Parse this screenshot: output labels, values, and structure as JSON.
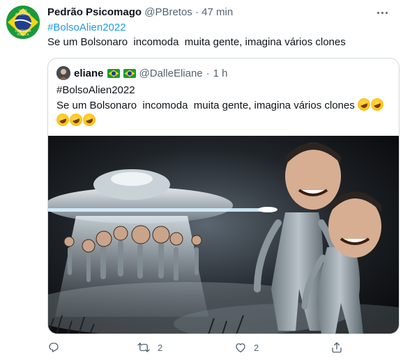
{
  "tweet": {
    "display_name": "Pedrão Psicomago",
    "handle": "@PBretos",
    "separator": "·",
    "time": "47 min",
    "hashtag": "#BolsoAlien2022",
    "text": "Se um Bolsonaro  incomoda  muita gente, imagina vários clones",
    "avatar_text": [
      "VOTO",
      "AUDITÁVEL",
      "CONTAGEM",
      "PÚBLICA"
    ]
  },
  "quoted": {
    "display_name": "eliane",
    "handle": "@DalleEliane",
    "separator": "·",
    "time": "1 h",
    "hashtag": "#BolsoAlien2022",
    "text": "Se um Bolsonaro  incomoda  muita gente, imagina vários clones",
    "emoji_count_line1": 2,
    "emoji_count_line2": 3
  },
  "actions": {
    "reply_count": "",
    "retweet_count": "2",
    "like_count": "2"
  },
  "colors": {
    "link": "#1d9bf0",
    "secondary_text": "#536471",
    "border": "#cfd9de"
  },
  "icons": [
    "more-icon",
    "reply-icon",
    "retweet-icon",
    "like-icon",
    "share-icon",
    "brazil-flag-icon",
    "laughing-emoji-icon"
  ]
}
